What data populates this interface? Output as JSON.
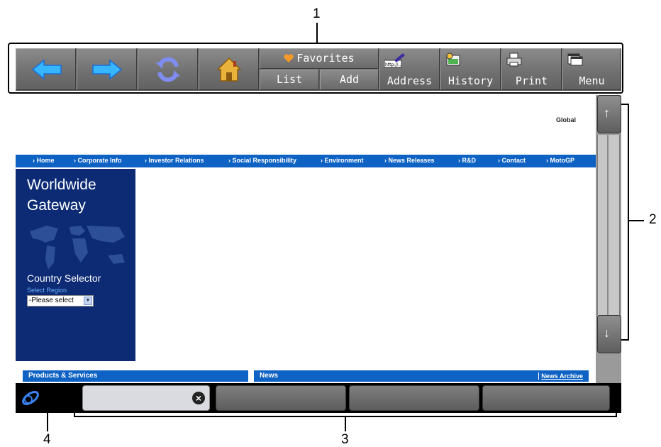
{
  "callouts": {
    "c1": "1",
    "c2": "2",
    "c3": "3",
    "c4": "4"
  },
  "toolbar": {
    "back_icon": "back-arrow-icon",
    "forward_icon": "forward-arrow-icon",
    "reload_icon": "reload-icon",
    "home_icon": "home-icon",
    "favorites_label": "Favorites",
    "favorites_list_label": "List",
    "favorites_add_label": "Add",
    "address_label": "Address",
    "address_icon_text": "http://..",
    "history_label": "History",
    "print_label": "Print",
    "menu_label": "Menu"
  },
  "page": {
    "global_label": "Global",
    "nav": [
      "› Home",
      "› Corporate Info",
      "› Investor Relations",
      "› Social Responsibility",
      "› Environment",
      "› News Releases",
      "› R&D",
      "› Contact",
      "› MotoGP"
    ],
    "gateway": {
      "title": "Worldwide Gateway",
      "country_selector": "Country Selector",
      "select_region": "Select Region",
      "dropdown_value": "-Please select"
    },
    "sections": {
      "products": "Products & Services",
      "news": "News",
      "news_archive": "News Archive"
    }
  },
  "colors": {
    "nav_blue": "#0e62c4",
    "gateway_navy": "#0c2b74",
    "toolbar_gray": "#6f6f6f",
    "tabbar_black": "#000000"
  }
}
